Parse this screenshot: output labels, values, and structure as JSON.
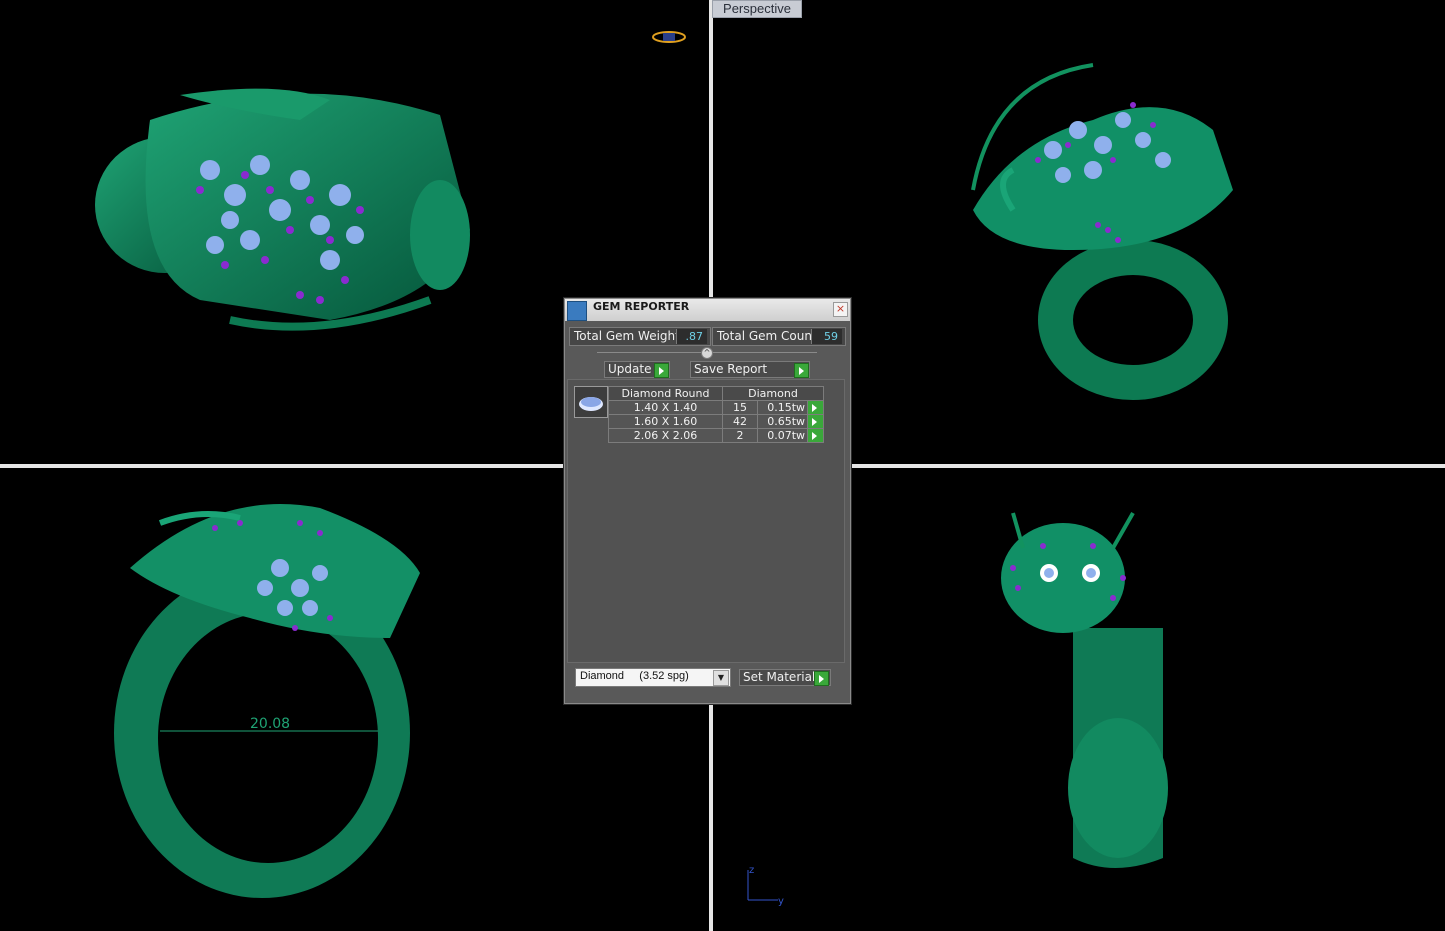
{
  "viewport": {
    "perspective_label": "Perspective",
    "dimension_label": "20.08",
    "axis_z": "z",
    "axis_y": "y"
  },
  "gem_reporter": {
    "title": "GEM REPORTER",
    "close_label": "×",
    "total_gem_weight_label": "Total Gem Weight",
    "total_gem_weight_value": ".87",
    "total_gem_count_label": "Total Gem Count",
    "total_gem_count_value": "59",
    "update_label": "Update",
    "save_report_label": "Save Report",
    "table": {
      "headers": [
        "Diamond Round",
        "Diamond"
      ],
      "rows": [
        {
          "size": "1.40 X 1.40",
          "count": "15",
          "weight": "0.15tw"
        },
        {
          "size": "1.60 X 1.60",
          "count": "42",
          "weight": "0.65tw"
        },
        {
          "size": "2.06 X 2.06",
          "count": "2",
          "weight": "0.07tw"
        }
      ]
    },
    "material_select_value": "Diamond     (3.52 spg)",
    "set_material_label": "Set Material"
  },
  "colors": {
    "model_green": "#0f7a55",
    "gem_blue": "#8fb0ec",
    "gem_purple": "#8a2bd0",
    "go_green": "#3aa83a",
    "value_cyan": "#6fd0e6"
  }
}
